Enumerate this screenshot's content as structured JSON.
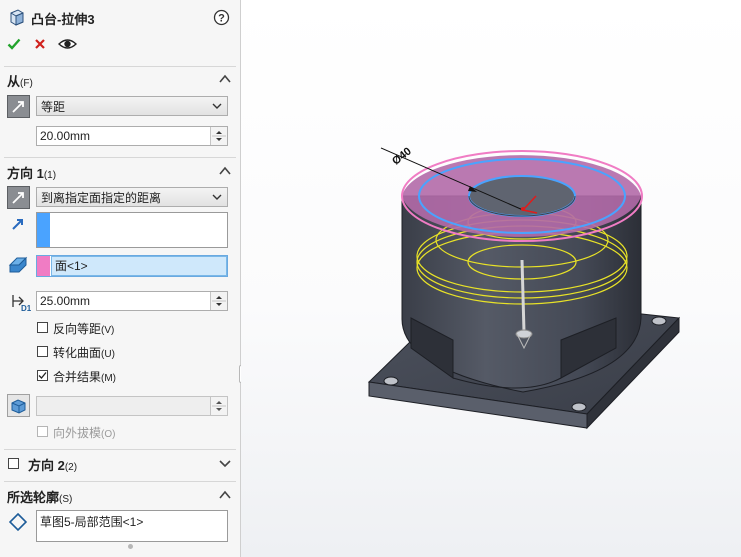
{
  "title": "凸台-拉伸3",
  "toolbar": {
    "ok_icon": "checkmark-icon",
    "cancel_icon": "close-icon",
    "preview_icon": "eye-icon",
    "help_icon": "help-icon"
  },
  "from_section": {
    "title": "从",
    "shortcut": "(F)",
    "type": "等距",
    "offset_value": "20.00mm"
  },
  "direction1": {
    "title": "方向 1",
    "shortcut": "(1)",
    "end_condition": "到离指定面指定的距离",
    "face_selection": "面<1>",
    "distance_value": "25.00mm",
    "reverse_offset": "反向等距",
    "reverse_offset_shortcut": "(V)",
    "transform_surface": "转化曲面",
    "transform_surface_shortcut": "(U)",
    "merge_result": "合并结果",
    "merge_result_shortcut": "(M)",
    "draft_outward": "向外拔模",
    "draft_outward_shortcut": "(O)"
  },
  "direction2": {
    "title": "方向 2",
    "shortcut": "(2)"
  },
  "contours": {
    "title": "所选轮廓",
    "shortcut": "(S)",
    "item": "草图5-局部范围<1>"
  },
  "viewport": {
    "dimension_label": "Ø40"
  },
  "colors": {
    "accent_blue": "#4aa3ff",
    "accent_pink": "#f07cc4",
    "highlight_blue": "#cfe8fb",
    "dark_bg": "#2c2f37"
  }
}
